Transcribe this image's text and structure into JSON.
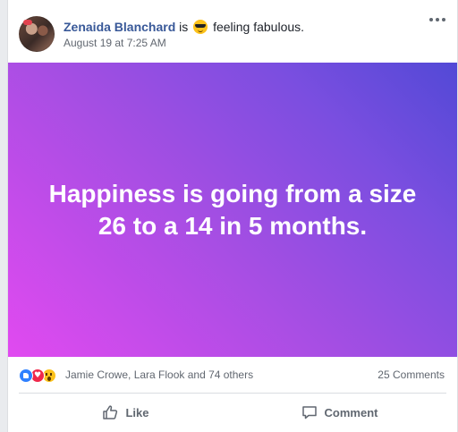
{
  "post": {
    "author": "Zenaida Blanchard",
    "verb": "is",
    "feeling_emoji": "sunglasses-emoji",
    "feeling": "feeling fabulous.",
    "timestamp": "August 19 at 7:25 AM",
    "banner_text": "Happiness is going from a size 26 to a 14 in 5 months.",
    "banner_colors": [
      "#e14af0",
      "#a54ee3",
      "#5249d6"
    ]
  },
  "reactions": {
    "icons": [
      "like-reaction-icon",
      "love-reaction-icon",
      "wow-reaction-icon"
    ],
    "names": "Jamie Crowe, Lara Flook and 74 others",
    "comments": "25 Comments"
  },
  "actions": {
    "like_label": "Like",
    "comment_label": "Comment"
  },
  "colors": {
    "link_blue": "#385898",
    "meta_gray": "#616770"
  }
}
